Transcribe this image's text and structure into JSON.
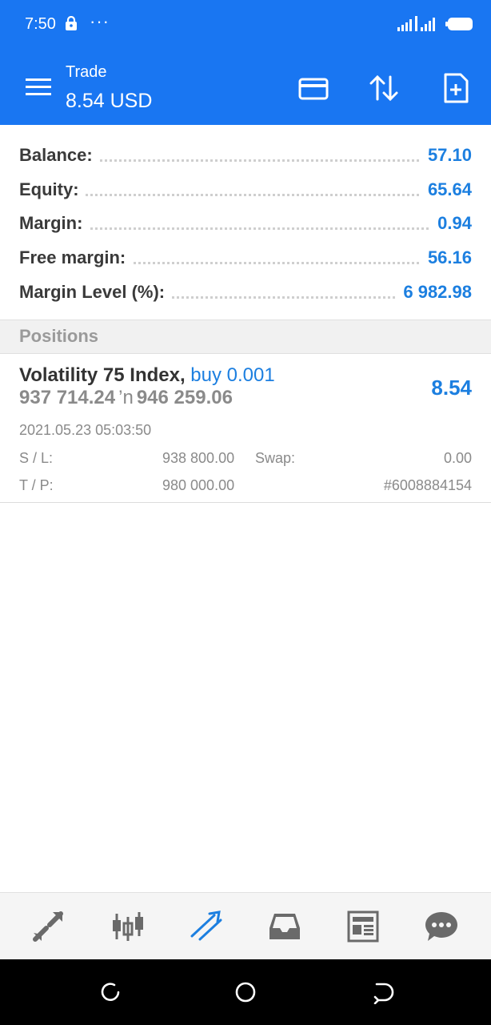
{
  "status_bar": {
    "time": "7:50",
    "dots": "···"
  },
  "app_bar": {
    "title": "Trade",
    "subtitle": "8.54 USD",
    "icons": [
      "menu-icon",
      "card-icon",
      "sort-arrows-icon",
      "new-order-icon"
    ]
  },
  "summary": [
    {
      "label": "Balance:",
      "value": "57.10"
    },
    {
      "label": "Equity:",
      "value": "65.64"
    },
    {
      "label": "Margin:",
      "value": "0.94"
    },
    {
      "label": "Free margin:",
      "value": "56.16"
    },
    {
      "label": "Margin Level (%):",
      "value": "6 982.98"
    }
  ],
  "positions": {
    "header": "Positions",
    "items": [
      {
        "symbol": "Volatility 75 Index,",
        "side": "buy 0.001",
        "open_price": "937 714.24",
        "arrow": "’n",
        "current_price": "946 259.06",
        "profit": "8.54",
        "time": "2021.05.23 05:03:50",
        "sl_label": "S / L:",
        "sl_value": "938 800.00",
        "swap_label": "Swap:",
        "swap_value": "0.00",
        "tp_label": "T / P:",
        "tp_value": "980 000.00",
        "ticket": "#6008884154"
      }
    ]
  },
  "bottom_nav": {
    "items": [
      "quotes-icon",
      "chart-icon",
      "trade-icon",
      "history-icon",
      "news-icon",
      "chat-icon"
    ],
    "active": "trade-icon"
  },
  "colors": {
    "primary": "#1976f2",
    "value_blue": "#1c7fe0",
    "label_dark": "#3a3a3a",
    "muted": "#8a8a8a"
  }
}
